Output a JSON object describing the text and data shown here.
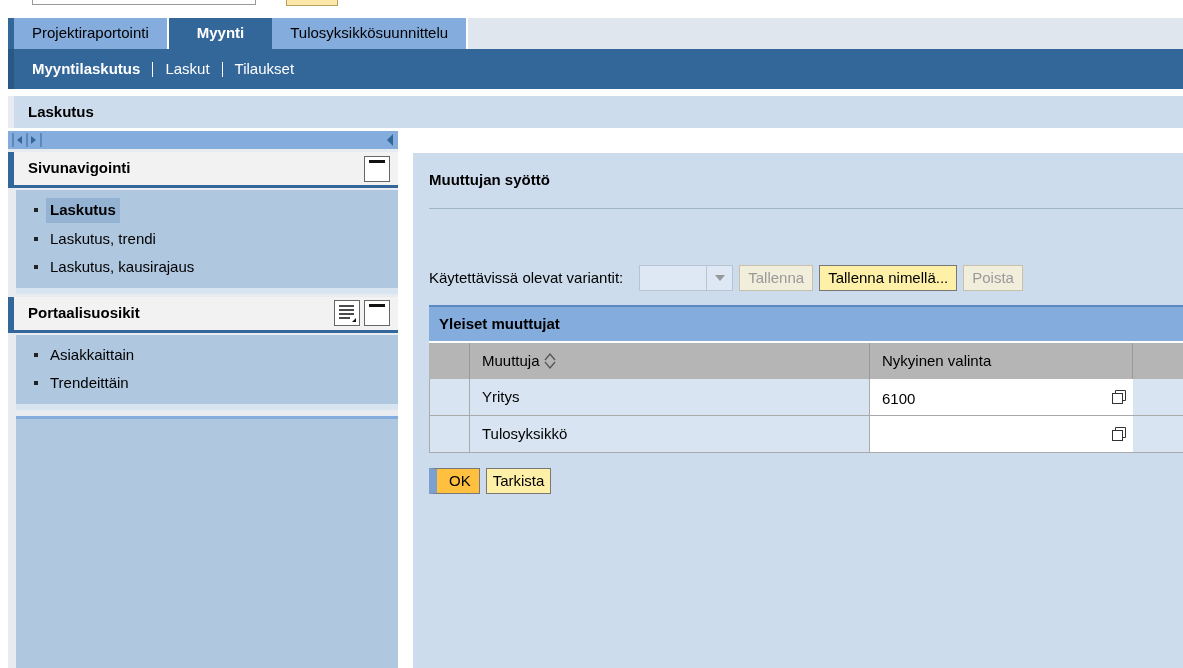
{
  "top_tabs": [
    {
      "label": "Projektiraportointi",
      "selected": false
    },
    {
      "label": "Myynti",
      "selected": true
    },
    {
      "label": "Tulosyksikkösuunnittelu",
      "selected": false
    }
  ],
  "sub_nav": [
    {
      "label": "Myyntilaskutus",
      "selected": true
    },
    {
      "label": "Laskut",
      "selected": false
    },
    {
      "label": "Tilaukset",
      "selected": false
    }
  ],
  "page_title": "Laskutus",
  "panels": [
    {
      "title": "Sivunavigointi",
      "has_options": false,
      "items": [
        {
          "label": "Laskutus",
          "selected": true
        },
        {
          "label": "Laskutus, trendi",
          "selected": false
        },
        {
          "label": "Laskutus, kausirajaus",
          "selected": false
        }
      ]
    },
    {
      "title": "Portaalisuosikit",
      "has_options": true,
      "items": [
        {
          "label": "Asiakkaittain",
          "selected": false
        },
        {
          "label": "Trendeittäin",
          "selected": false
        }
      ]
    }
  ],
  "main": {
    "title": "Muuttujan syöttö",
    "variants_label": "Käytettävissä olevat variantit:",
    "variant_select": {
      "disabled": true
    },
    "variant_buttons": [
      {
        "label": "Tallenna",
        "disabled": true
      },
      {
        "label": "Tallenna nimellä...",
        "disabled": false
      },
      {
        "label": "Poista",
        "disabled": true
      }
    ],
    "table": {
      "title": "Yleiset muuttujat",
      "columns": [
        "Muuttuja",
        "Nykyinen valinta"
      ],
      "rows": [
        {
          "name": "Yritys",
          "value": "6100"
        },
        {
          "name": "Tulosyksikkö",
          "value": ""
        }
      ]
    },
    "buttons": [
      {
        "label": "OK",
        "primary": true
      },
      {
        "label": "Tarkista",
        "primary": false
      }
    ]
  }
}
